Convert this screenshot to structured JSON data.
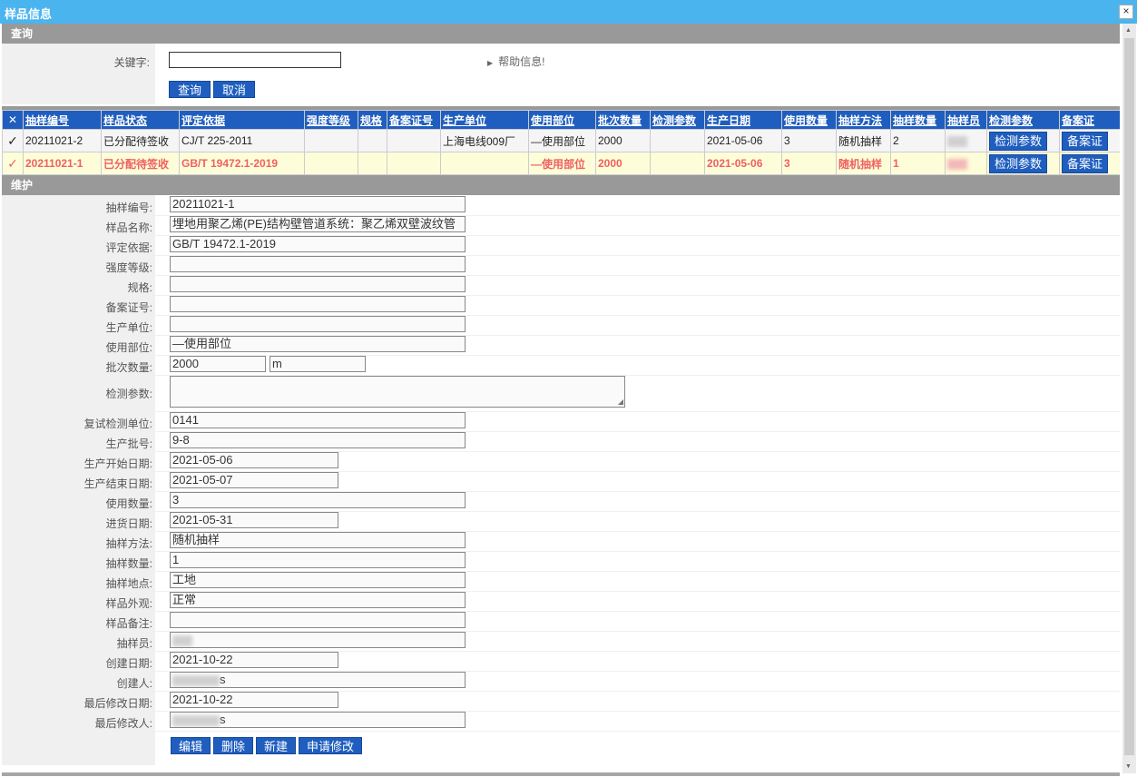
{
  "window": {
    "title": "样品信息",
    "close": "×"
  },
  "query": {
    "section_title": "查询",
    "keyword_label": "关键字:",
    "keyword_value": "",
    "help_text": "帮助信息!",
    "search_button": "查询",
    "cancel_button": "取消"
  },
  "grid": {
    "select_all": "✕",
    "columns": [
      "抽样编号",
      "样品状态",
      "评定依据",
      "强度等级",
      "规格",
      "备案证号",
      "生产单位",
      "使用部位",
      "批次数量",
      "检测参数",
      "生产日期",
      "使用数量",
      "抽样方法",
      "抽样数量",
      "抽样员",
      "检测参数",
      "备案证"
    ],
    "rows": [
      {
        "check": "✓",
        "sample_no": "20211021-2",
        "status": "已分配待签收",
        "standard": "CJ/T 225-2011",
        "strength": "",
        "spec": "",
        "record_no": "",
        "producer": "上海电线009厂",
        "part": "—使用部位",
        "batch_qty": "2000",
        "test_param": "",
        "prod_date": "2021-05-06",
        "use_qty": "3",
        "method": "随机抽样",
        "sample_qty": "2",
        "sampler": "",
        "btn_param": "检测参数",
        "btn_record": "备案证"
      },
      {
        "check": "✓",
        "sample_no": "20211021-1",
        "status": "已分配待签收",
        "standard": "GB/T 19472.1-2019",
        "strength": "",
        "spec": "",
        "record_no": "",
        "producer": "",
        "part": "—使用部位",
        "batch_qty": "2000",
        "test_param": "",
        "prod_date": "2021-05-06",
        "use_qty": "3",
        "method": "随机抽样",
        "sample_qty": "1",
        "sampler": "",
        "btn_param": "检测参数",
        "btn_record": "备案证"
      }
    ]
  },
  "form": {
    "section_title": "维护",
    "fields": {
      "sample_no": {
        "label": "抽样编号:",
        "value": "20211021-1"
      },
      "sample_name": {
        "label": "样品名称:",
        "value": "埋地用聚乙烯(PE)结构壁管道系统：聚乙烯双壁波纹管"
      },
      "standard": {
        "label": "评定依据:",
        "value": "GB/T 19472.1-2019"
      },
      "strength": {
        "label": "强度等级:",
        "value": ""
      },
      "spec": {
        "label": "规格:",
        "value": ""
      },
      "record_no": {
        "label": "备案证号:",
        "value": ""
      },
      "producer": {
        "label": "生产单位:",
        "value": ""
      },
      "part": {
        "label": "使用部位:",
        "value": "—使用部位"
      },
      "batch_qty": {
        "label": "批次数量:",
        "value": "2000",
        "unit": "m"
      },
      "test_param": {
        "label": "检测参数:",
        "value": ""
      },
      "retest_unit": {
        "label": "复试检测单位:",
        "value": "0141"
      },
      "batch_no": {
        "label": "生产批号:",
        "value": "9-8"
      },
      "prod_start": {
        "label": "生产开始日期:",
        "value": "2021-05-06"
      },
      "prod_end": {
        "label": "生产结束日期:",
        "value": "2021-05-07"
      },
      "use_qty": {
        "label": "使用数量:",
        "value": "3"
      },
      "purchase_date": {
        "label": "进货日期:",
        "value": "2021-05-31"
      },
      "method": {
        "label": "抽样方法:",
        "value": "随机抽样"
      },
      "sample_qty": {
        "label": "抽样数量:",
        "value": "1"
      },
      "location": {
        "label": "抽样地点:",
        "value": "工地"
      },
      "appearance": {
        "label": "样品外观:",
        "value": "正常"
      },
      "remark": {
        "label": "样品备注:",
        "value": ""
      },
      "sampler": {
        "label": "抽样员:",
        "value": ""
      },
      "created_date": {
        "label": "创建日期:",
        "value": "2021-10-22"
      },
      "creator": {
        "label": "创建人:",
        "value": "s"
      },
      "modified_date": {
        "label": "最后修改日期:",
        "value": "2021-10-22"
      },
      "modifier": {
        "label": "最后修改人:",
        "value": "s"
      }
    },
    "buttons": {
      "edit": "编辑",
      "delete": "删除",
      "new": "新建",
      "request_change": "申请修改"
    }
  },
  "colors": {
    "titlebar": "#4ab4ef",
    "section": "#999999",
    "button": "#1f5ebf",
    "highlight_row": "#fdfdd9",
    "highlight_text": "#f06060"
  }
}
